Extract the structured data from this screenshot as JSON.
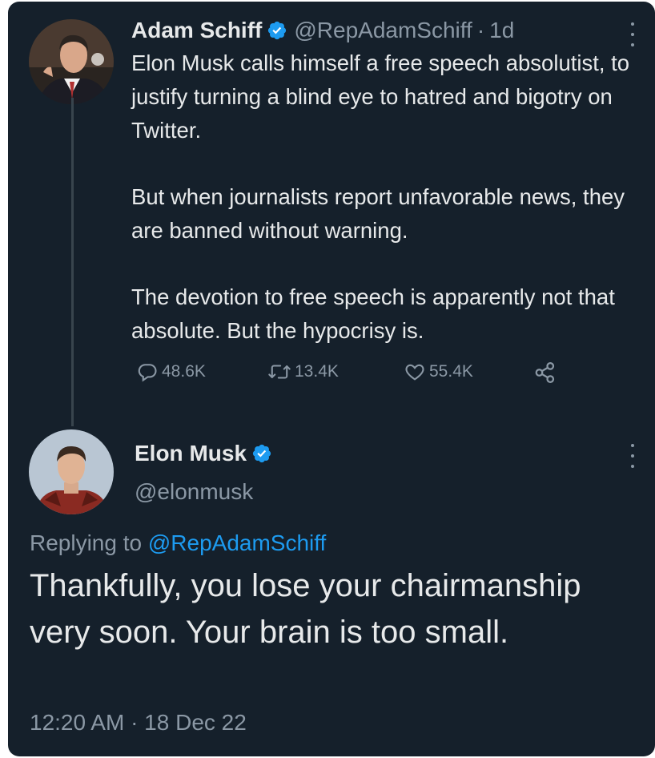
{
  "tweet": {
    "author": {
      "name": "Adam Schiff",
      "handle": "@RepAdamSchiff",
      "separator": "·",
      "time": "1d"
    },
    "paragraphs": [
      "Elon Musk calls himself a free speech absolutist, to justify turning a blind eye to hatred and bigotry on Twitter.",
      "But when journalists report unfavorable news, they are banned without warning.",
      "The devotion to free speech is apparently not that absolute. But the hypocrisy is."
    ],
    "stats": {
      "replies": "48.6K",
      "retweets": "13.4K",
      "likes": "55.4K"
    }
  },
  "reply": {
    "author": {
      "name": "Elon Musk",
      "handle": "@elonmusk"
    },
    "replying_prefix": "Replying to",
    "replying_handle": "@RepAdamSchiff",
    "text": "Thankfully, you lose your chairmanship very soon. Your brain is too small.",
    "timestamp": "12:20 AM · 18 Dec 22"
  },
  "colors": {
    "background": "#15202b",
    "text_primary": "#e7e9ea",
    "text_secondary": "#8b98a5",
    "accent": "#1d9bf0",
    "thread_line": "#38444d"
  },
  "icons": {
    "verified": "verified-badge-icon",
    "reply": "reply-icon",
    "retweet": "retweet-icon",
    "like": "heart-icon",
    "share": "share-icon",
    "more": "more-vertical-icon"
  }
}
